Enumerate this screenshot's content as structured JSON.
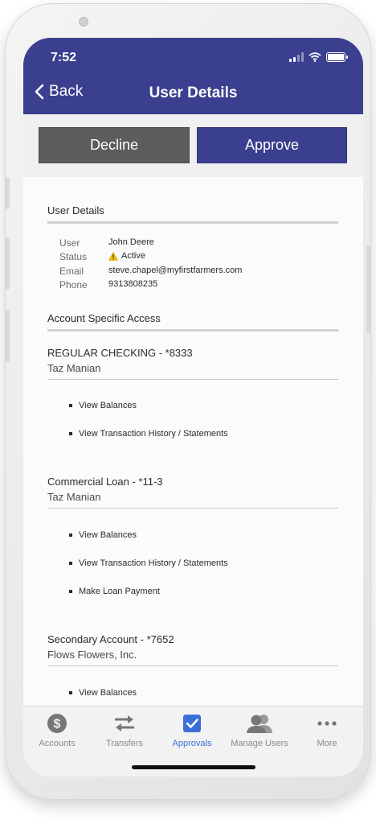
{
  "status_bar": {
    "time": "7:52"
  },
  "header": {
    "back_label": "Back",
    "title": "User Details"
  },
  "actions": {
    "decline_label": "Decline",
    "approve_label": "Approve"
  },
  "user_details": {
    "section_title": "User Details",
    "fields": [
      {
        "label": "User",
        "value": "John Deere"
      },
      {
        "label": "Status",
        "value": "Active"
      },
      {
        "label": "Email",
        "value": "steve.chapel@myfirstfarmers.com"
      },
      {
        "label": "Phone",
        "value": "9313808235"
      }
    ]
  },
  "account_access": {
    "section_title": "Account Specific Access",
    "accounts": [
      {
        "name": "REGULAR CHECKING - *8333",
        "owner": "Taz Manian",
        "permissions": [
          "View Balances",
          "View Transaction History / Statements"
        ]
      },
      {
        "name": "Commercial Loan - *11-3",
        "owner": "Taz Manian",
        "permissions": [
          "View Balances",
          "View Transaction History / Statements",
          "Make Loan Payment"
        ]
      },
      {
        "name": "Secondary Account - *7652",
        "owner": "Flows Flowers, Inc.",
        "permissions": [
          "View Balances"
        ]
      }
    ]
  },
  "tabbar": {
    "items": [
      {
        "label": "Accounts",
        "icon": "dollar-coin-icon"
      },
      {
        "label": "Transfers",
        "icon": "transfer-arrows-icon"
      },
      {
        "label": "Approvals",
        "icon": "checkbox-icon",
        "active": true
      },
      {
        "label": "Manage Users",
        "icon": "users-icon"
      },
      {
        "label": "More",
        "icon": "more-dots-icon"
      }
    ]
  },
  "colors": {
    "brand": "#3a3f8f",
    "decline": "#5c5c5c",
    "active_tab": "#3a6fd8",
    "warning": "#f2c200"
  }
}
